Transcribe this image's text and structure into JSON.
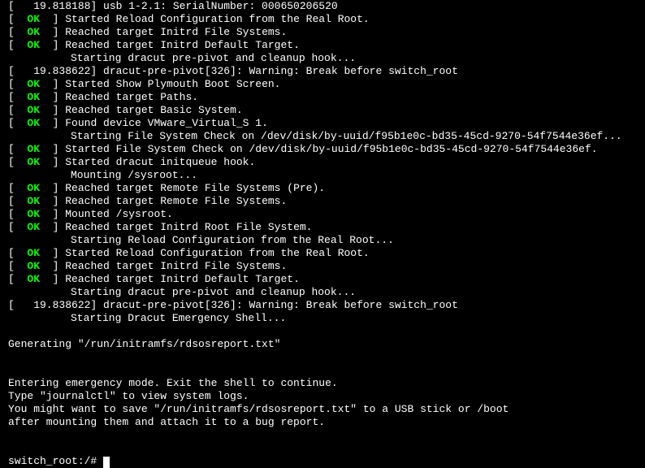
{
  "lines": [
    {
      "type": "ts",
      "text": "[   19.818188] usb 1-2.1: SerialNumber: 000650206520"
    },
    {
      "type": "ok",
      "msg": "Started Reload Configuration from the Real Root."
    },
    {
      "type": "ok",
      "msg": "Reached target Initrd File Systems."
    },
    {
      "type": "ok",
      "msg": "Reached target Initrd Default Target."
    },
    {
      "type": "indent",
      "msg": "Starting dracut pre-pivot and cleanup hook..."
    },
    {
      "type": "ts",
      "text": "[   19.838622] dracut-pre-pivot[326]: Warning: Break before switch_root"
    },
    {
      "type": "ok",
      "msg": "Started Show Plymouth Boot Screen."
    },
    {
      "type": "ok",
      "msg": "Reached target Paths."
    },
    {
      "type": "ok",
      "msg": "Reached target Basic System."
    },
    {
      "type": "ok",
      "msg": "Found device VMware_Virtual_S 1."
    },
    {
      "type": "indent",
      "msg": "Starting File System Check on /dev/disk/by-uuid/f95b1e0c-bd35-45cd-9270-54f7544e36ef..."
    },
    {
      "type": "ok",
      "msg": "Started File System Check on /dev/disk/by-uuid/f95b1e0c-bd35-45cd-9270-54f7544e36ef."
    },
    {
      "type": "ok",
      "msg": "Started dracut initqueue hook."
    },
    {
      "type": "indent",
      "msg": "Mounting /sysroot..."
    },
    {
      "type": "ok",
      "msg": "Reached target Remote File Systems (Pre)."
    },
    {
      "type": "ok",
      "msg": "Reached target Remote File Systems."
    },
    {
      "type": "ok",
      "msg": "Mounted /sysroot."
    },
    {
      "type": "ok",
      "msg": "Reached target Initrd Root File System."
    },
    {
      "type": "indent",
      "msg": "Starting Reload Configuration from the Real Root..."
    },
    {
      "type": "ok",
      "msg": "Started Reload Configuration from the Real Root."
    },
    {
      "type": "ok",
      "msg": "Reached target Initrd File Systems."
    },
    {
      "type": "ok",
      "msg": "Reached target Initrd Default Target."
    },
    {
      "type": "indent",
      "msg": "Starting dracut pre-pivot and cleanup hook..."
    },
    {
      "type": "ts",
      "text": "[   19.838622] dracut-pre-pivot[326]: Warning: Break before switch_root"
    },
    {
      "type": "indent",
      "msg": "Starting Dracut Emergency Shell..."
    },
    {
      "type": "blank"
    },
    {
      "type": "plain",
      "text": "Generating \"/run/initramfs/rdsosreport.txt\""
    },
    {
      "type": "blank"
    },
    {
      "type": "blank"
    },
    {
      "type": "plain",
      "text": "Entering emergency mode. Exit the shell to continue."
    },
    {
      "type": "plain",
      "text": "Type \"journalctl\" to view system logs."
    },
    {
      "type": "plain",
      "text": "You might want to save \"/run/initramfs/rdsosreport.txt\" to a USB stick or /boot"
    },
    {
      "type": "plain",
      "text": "after mounting them and attach it to a bug report."
    },
    {
      "type": "blank"
    },
    {
      "type": "blank"
    }
  ],
  "status_ok": "OK",
  "prompt": "switch_root:/# "
}
